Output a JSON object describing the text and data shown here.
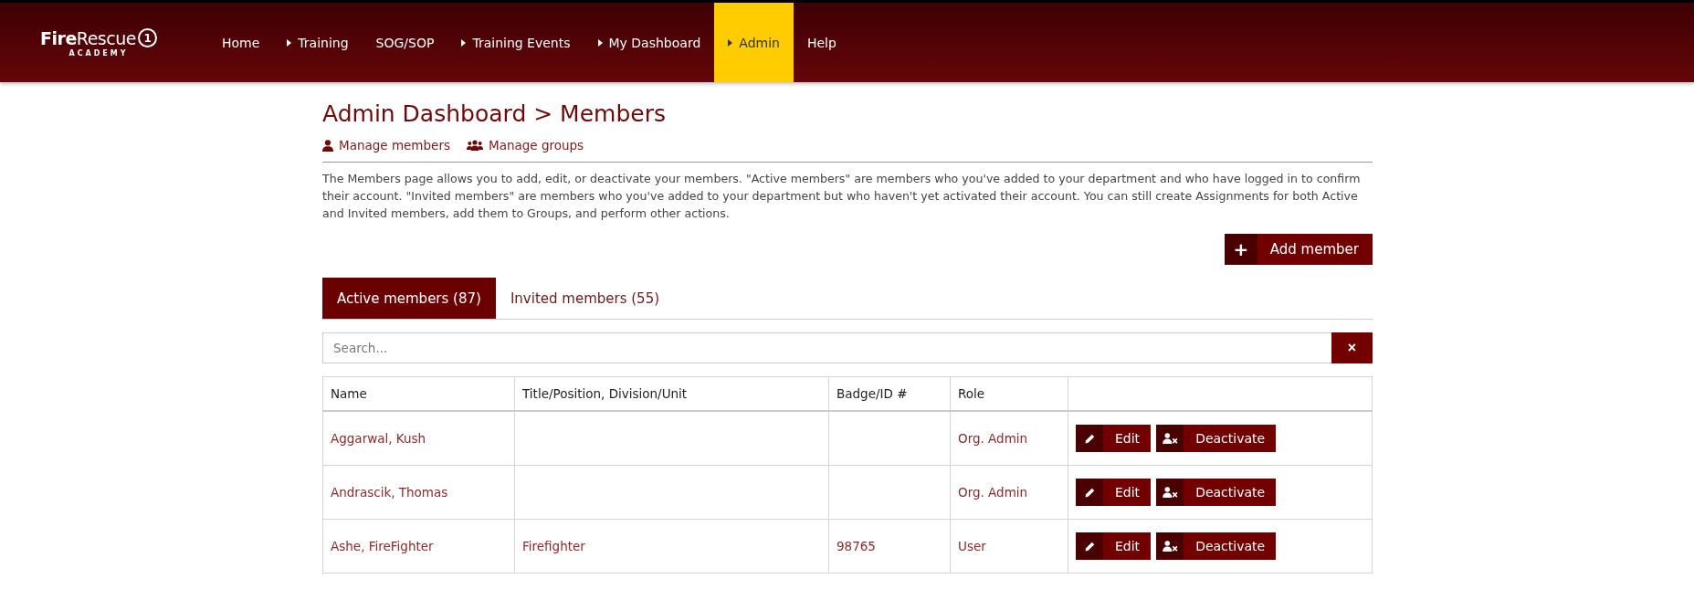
{
  "logo": {
    "brand_bold": "Fire",
    "brand_regular": "Rescue",
    "brand_number": "1",
    "subtitle": "ACADEMY"
  },
  "nav": [
    {
      "label": "Home",
      "has_menu": false,
      "selected": false
    },
    {
      "label": "Training",
      "has_menu": true,
      "selected": false
    },
    {
      "label": "SOG/SOP",
      "has_menu": false,
      "selected": false
    },
    {
      "label": "Training Events",
      "has_menu": true,
      "selected": false
    },
    {
      "label": "My Dashboard",
      "has_menu": true,
      "selected": false
    },
    {
      "label": "Admin",
      "has_menu": true,
      "selected": true
    },
    {
      "label": "Help",
      "has_menu": false,
      "selected": false
    }
  ],
  "page_title": "Admin Dashboard > Members",
  "sub_links": [
    {
      "kind": "person",
      "label": "Manage members"
    },
    {
      "kind": "group",
      "label": "Manage groups"
    }
  ],
  "description": "The Members page allows you to add, edit, or deactivate your members. \"Active members\" are members who you've added to your department and who have logged in to confirm their account. \"Invited members\" are members who you've added to your department but who haven't yet activated their account. You can still create Assignments for both Active and Invited members, add them to Groups, and perform other actions.",
  "add_button": {
    "icon": "+",
    "label": "Add member"
  },
  "tabs": [
    {
      "label": "Active members (87)",
      "selected": true
    },
    {
      "label": "Invited members (55)",
      "selected": false
    }
  ],
  "search": {
    "placeholder": "Search...",
    "clear": "×"
  },
  "table": {
    "columns": [
      "Name",
      "Title/Position, Division/Unit",
      "Badge/ID #",
      "Role"
    ],
    "rows": [
      {
        "name": "Aggarwal, Kush",
        "title": "",
        "badge": "",
        "role": "Org. Admin",
        "edit": "Edit",
        "deactivate": "Deactivate"
      },
      {
        "name": "Andrascik, Thomas",
        "title": "",
        "badge": "",
        "role": "Org. Admin",
        "edit": "Edit",
        "deactivate": "Deactivate"
      },
      {
        "name": "Ashe, FireFighter",
        "title": "Firefighter",
        "badge": "98765",
        "role": "User",
        "edit": "Edit",
        "deactivate": "Deactivate"
      }
    ]
  }
}
